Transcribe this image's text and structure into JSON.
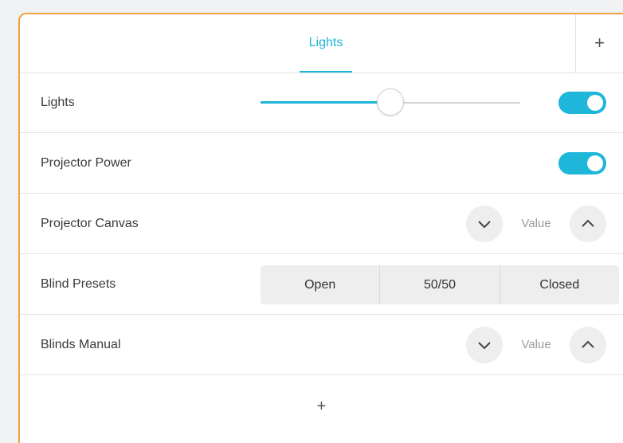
{
  "tabs": [
    {
      "label": "Lights",
      "active": true
    }
  ],
  "tab_add_label": "+",
  "rows": {
    "lights": {
      "label": "Lights",
      "slider_value": 0.5,
      "toggle_on": true
    },
    "projector_power": {
      "label": "Projector Power",
      "toggle_on": true
    },
    "projector_canvas": {
      "label": "Projector Canvas",
      "value_text": "Value"
    },
    "blind_presets": {
      "label": "Blind Presets",
      "options": [
        "Open",
        "50/50",
        "Closed"
      ]
    },
    "blinds_manual": {
      "label": "Blinds Manual",
      "value_text": "Value"
    }
  },
  "add_row_label": "+",
  "colors": {
    "accent": "#1eb6d9",
    "panel_border": "#f0a33d"
  },
  "icons": {
    "spin_down": "chevron-down-icon",
    "spin_up": "chevron-up-icon"
  }
}
